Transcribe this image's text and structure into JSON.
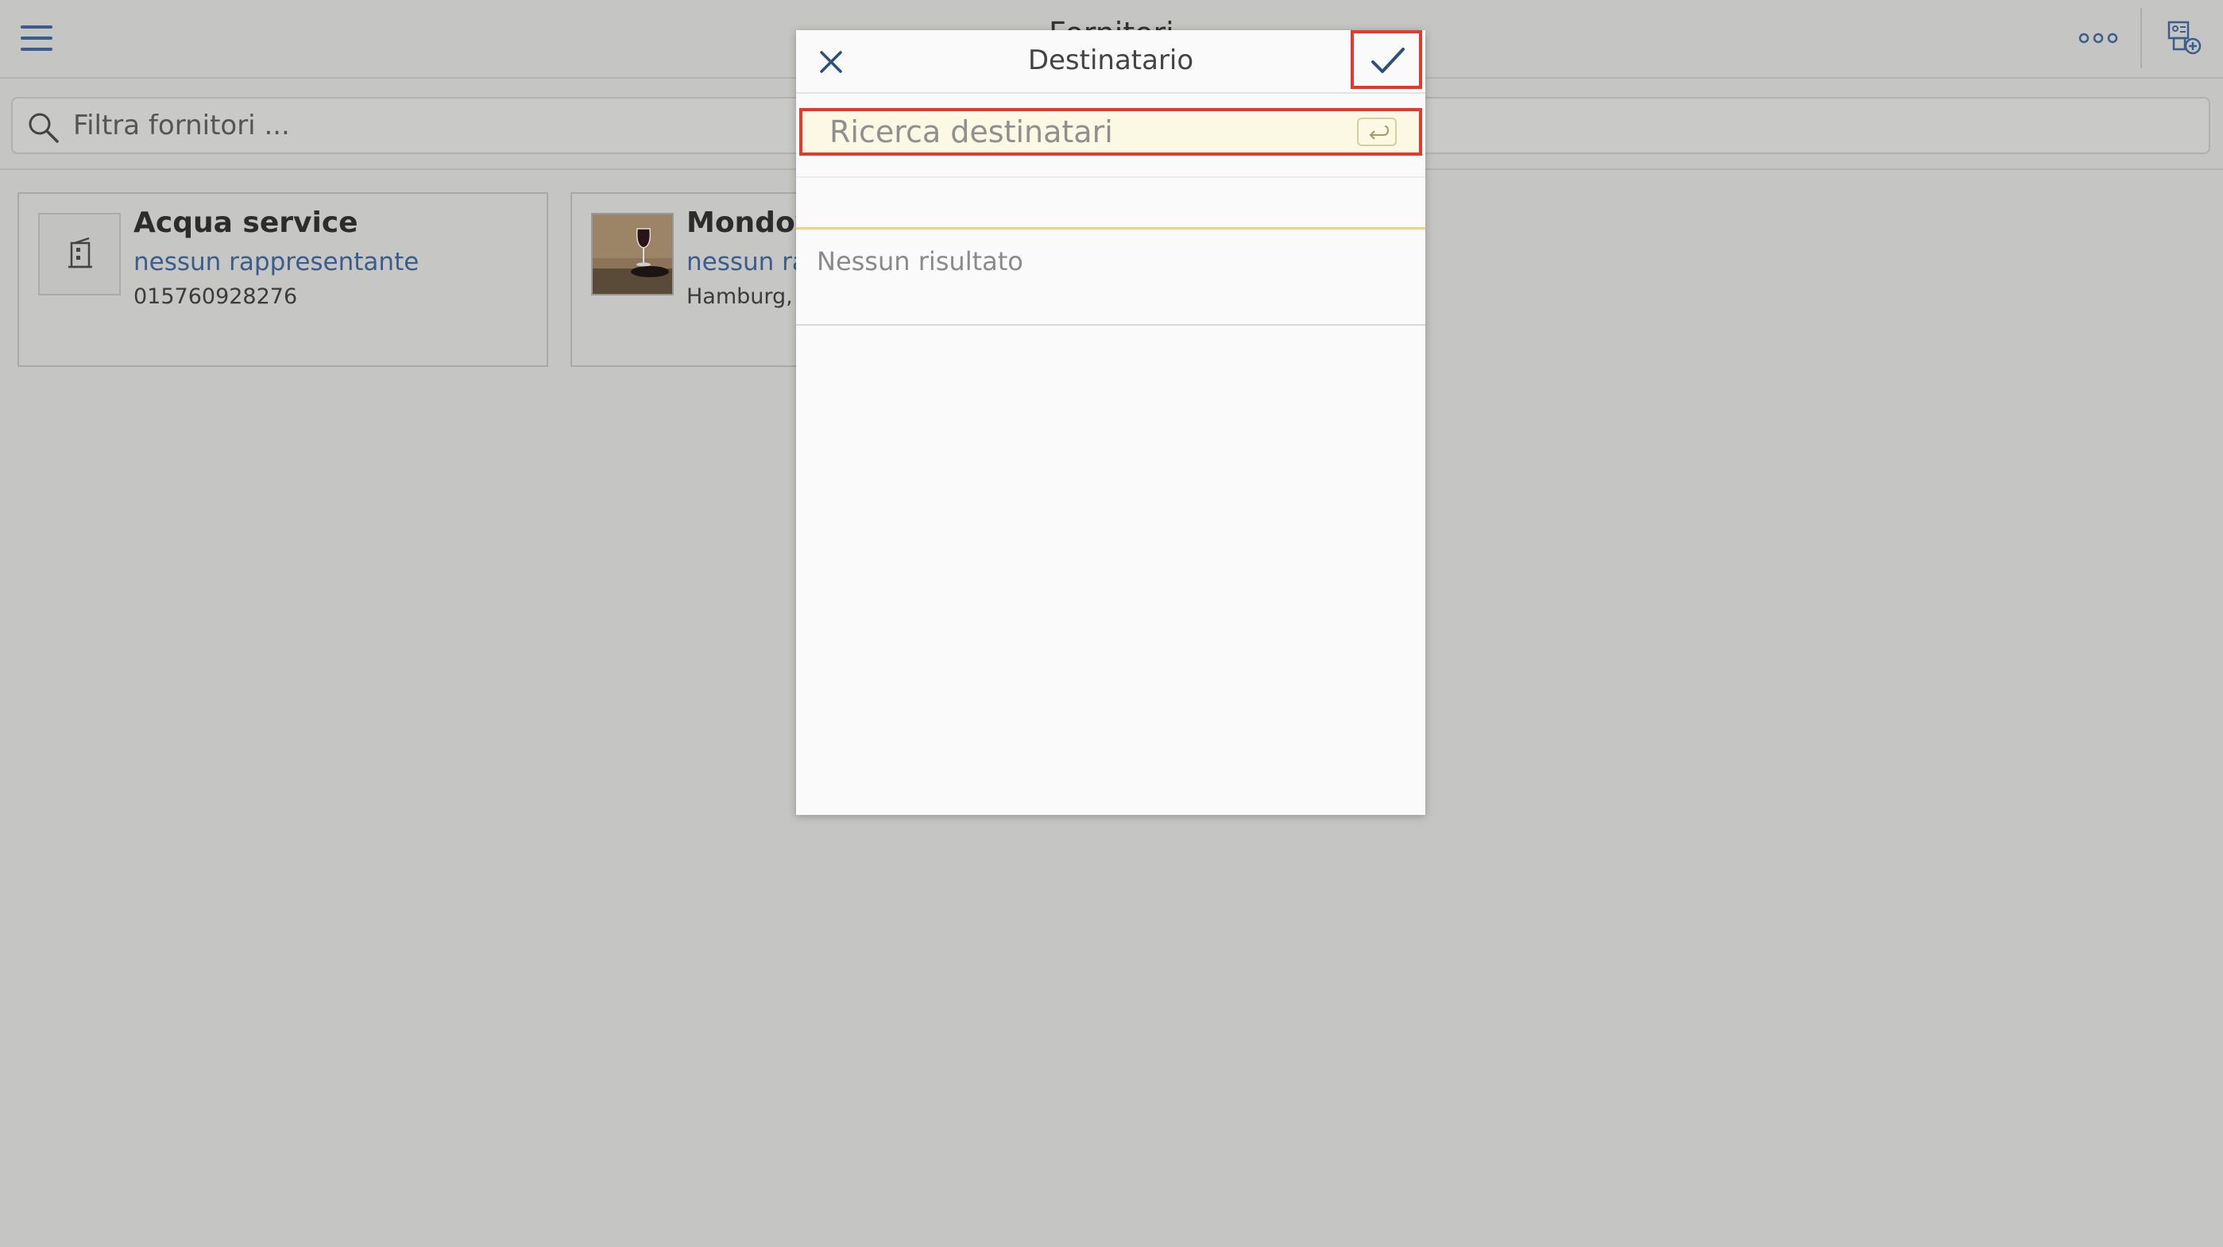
{
  "app": {
    "title": "Fornitori",
    "search_placeholder": "Filtra fornitori ..."
  },
  "suppliers": [
    {
      "name": "Acqua service",
      "representative": "nessun rappresentante",
      "extra": "015760928276"
    },
    {
      "name": "Mondovino",
      "representative": "nessun rappresentante",
      "extra": "Hamburg, Germany"
    }
  ],
  "dialog": {
    "title": "Destinatario",
    "search_placeholder": "Ricerca destinatari",
    "empty_text": "Nessun risultato"
  },
  "colors": {
    "accent": "#3a5d8c",
    "highlight": "#e23b2e",
    "input_bg": "#fbf8e3"
  },
  "icons": [
    "menu-icon",
    "more-icon",
    "add-contact-icon",
    "search-icon",
    "building-icon",
    "close-icon",
    "check-icon",
    "enter-icon"
  ]
}
